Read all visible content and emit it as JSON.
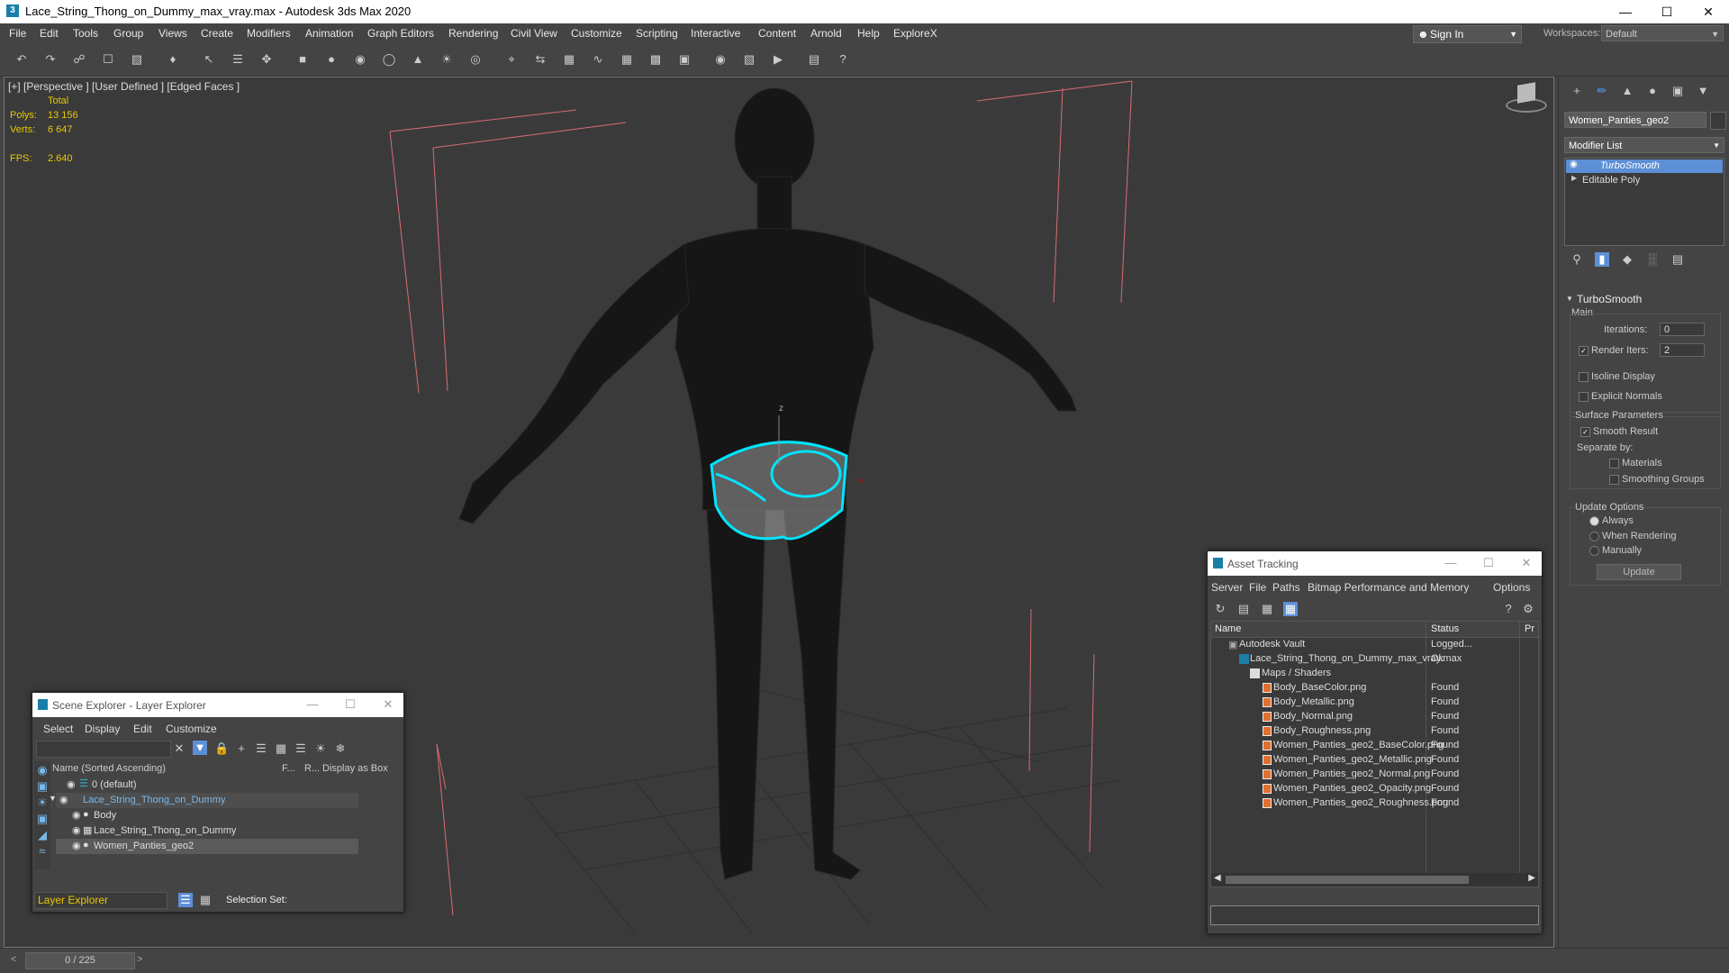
{
  "window": {
    "title": "Lace_String_Thong_on_Dummy_max_vray.max - Autodesk 3ds Max 2020",
    "app_icon": "3",
    "minimize": "—",
    "maximize": "☐",
    "close": "✕"
  },
  "menu": {
    "items": [
      "File",
      "Edit",
      "Tools",
      "Group",
      "Views",
      "Create",
      "Modifiers",
      "Animation",
      "Graph Editors",
      "Rendering",
      "Civil View",
      "Customize",
      "Scripting",
      "Interactive",
      "Content",
      "Arnold",
      "Help",
      "ExploreX"
    ],
    "sign_in": "Sign In",
    "workspaces_label": "Workspaces:",
    "workspace_value": "Default"
  },
  "viewport": {
    "label": "[+] [Perspective ] [User Defined ] [Edged Faces ]",
    "stats": {
      "total_label": "Total",
      "polys_label": "Polys:",
      "polys_value": "13 156",
      "verts_label": "Verts:",
      "verts_value": "6 647",
      "fps_label": "FPS:",
      "fps_value": "2.640"
    },
    "axis_z": "z",
    "axis_x": "x"
  },
  "command_panel": {
    "object_name": "Women_Panties_geo2",
    "modifier_list_label": "Modifier List",
    "stack": [
      "TurboSmooth",
      "Editable Poly"
    ],
    "rollout_title": "TurboSmooth",
    "main_label": "Main",
    "iterations_label": "Iterations:",
    "iterations_value": "0",
    "render_iters_label": "Render Iters:",
    "render_iters_value": "2",
    "isoline_label": "Isoline Display",
    "explicit_normals_label": "Explicit Normals",
    "surface_params_label": "Surface Parameters",
    "smooth_result_label": "Smooth Result",
    "separate_by_label": "Separate by:",
    "materials_label": "Materials",
    "smoothing_groups_label": "Smoothing Groups",
    "update_options_label": "Update Options",
    "always_label": "Always",
    "when_rendering_label": "When Rendering",
    "manually_label": "Manually",
    "update_button": "Update"
  },
  "scene_explorer": {
    "title": "Scene Explorer - Layer Explorer",
    "menu": [
      "Select",
      "Display",
      "Edit",
      "Customize"
    ],
    "columns": [
      "Name (Sorted Ascending)",
      "F...",
      "R...",
      "Display as Box"
    ],
    "rows": [
      {
        "name": "0 (default)"
      },
      {
        "name": "Lace_String_Thong_on_Dummy"
      },
      {
        "name": "Body"
      },
      {
        "name": "Lace_String_Thong_on_Dummy"
      },
      {
        "name": "Women_Panties_geo2"
      }
    ],
    "footer_dropdown": "Layer Explorer",
    "selection_set_label": "Selection Set:"
  },
  "asset_tracking": {
    "title": "Asset Tracking",
    "menu": [
      "Server",
      "File",
      "Paths",
      "Bitmap Performance and Memory",
      "Options"
    ],
    "columns": [
      "Name",
      "Status",
      "Pr"
    ],
    "rows": [
      {
        "name": "Autodesk Vault",
        "status": "Logged..."
      },
      {
        "name": "Lace_String_Thong_on_Dummy_max_vray.max",
        "status": "Ok"
      },
      {
        "name": "Maps / Shaders",
        "status": ""
      },
      {
        "name": "Body_BaseColor.png",
        "status": "Found"
      },
      {
        "name": "Body_Metallic.png",
        "status": "Found"
      },
      {
        "name": "Body_Normal.png",
        "status": "Found"
      },
      {
        "name": "Body_Roughness.png",
        "status": "Found"
      },
      {
        "name": "Women_Panties_geo2_BaseColor.png",
        "status": "Found"
      },
      {
        "name": "Women_Panties_geo2_Metallic.png",
        "status": "Found"
      },
      {
        "name": "Women_Panties_geo2_Normal.png",
        "status": "Found"
      },
      {
        "name": "Women_Panties_geo2_Opacity.png",
        "status": "Found"
      },
      {
        "name": "Women_Panties_geo2_Roughness.png",
        "status": "Found"
      }
    ]
  },
  "timeline": {
    "frame": "0 / 225"
  },
  "colors": {
    "accent": "#00e5ff",
    "selection_blue": "#5c8fd6",
    "stats_yellow": "#e8c800",
    "bounding_box": "#e07a80"
  }
}
